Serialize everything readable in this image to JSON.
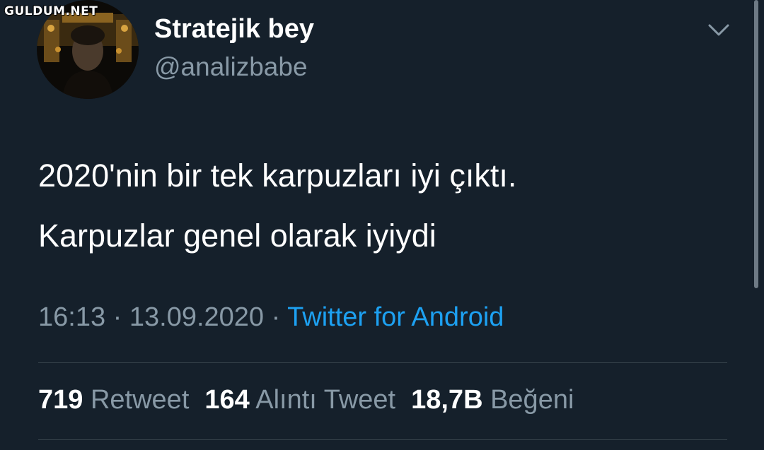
{
  "watermark": "GULDUM.NET",
  "user": {
    "display_name": "Stratejik bey",
    "handle": "@analizbabe"
  },
  "tweet": {
    "lines": [
      "2020'nin bir tek karpuzları iyi çıktı.",
      "Karpuzlar genel olarak iyiydi"
    ],
    "time": "16:13",
    "separator": "·",
    "date": "13.09.2020",
    "source": "Twitter for Android"
  },
  "stats": {
    "retweets": {
      "count": "719",
      "label": "Retweet"
    },
    "quotes": {
      "count": "164",
      "label": "Alıntı Tweet"
    },
    "likes": {
      "count": "18,7B",
      "label": "Beğeni"
    }
  },
  "icons": {
    "menu": "chevron-down-icon"
  },
  "colors": {
    "background": "#15202b",
    "secondary_text": "#8899a6",
    "link": "#1da1f2",
    "divider": "#38444d"
  }
}
